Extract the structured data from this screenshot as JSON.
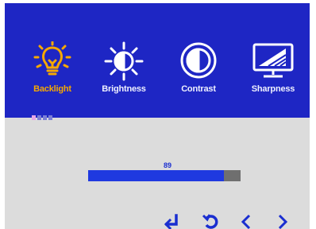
{
  "menu": {
    "items": [
      {
        "label": "Backlight",
        "icon": "lightbulb-icon",
        "active": true
      },
      {
        "label": "Brightness",
        "icon": "sun-icon",
        "active": false
      },
      {
        "label": "Contrast",
        "icon": "contrast-icon",
        "active": false
      },
      {
        "label": "Sharpness",
        "icon": "monitor-sharpness-icon",
        "active": false
      }
    ],
    "page_dots": 4,
    "active_page": 0
  },
  "slider": {
    "value": "89",
    "fill_fraction": 0.89
  },
  "nav_buttons": [
    {
      "icon": "enter-icon"
    },
    {
      "icon": "back-icon"
    },
    {
      "icon": "chevron-left-icon"
    },
    {
      "icon": "chevron-right-icon"
    }
  ],
  "colors": {
    "header_bg": "#1e26c4",
    "active_accent": "#f6a800",
    "bar_fill": "#1f39e0",
    "bar_track": "#6f6f6f",
    "panel_bg": "#dcdcdc"
  }
}
